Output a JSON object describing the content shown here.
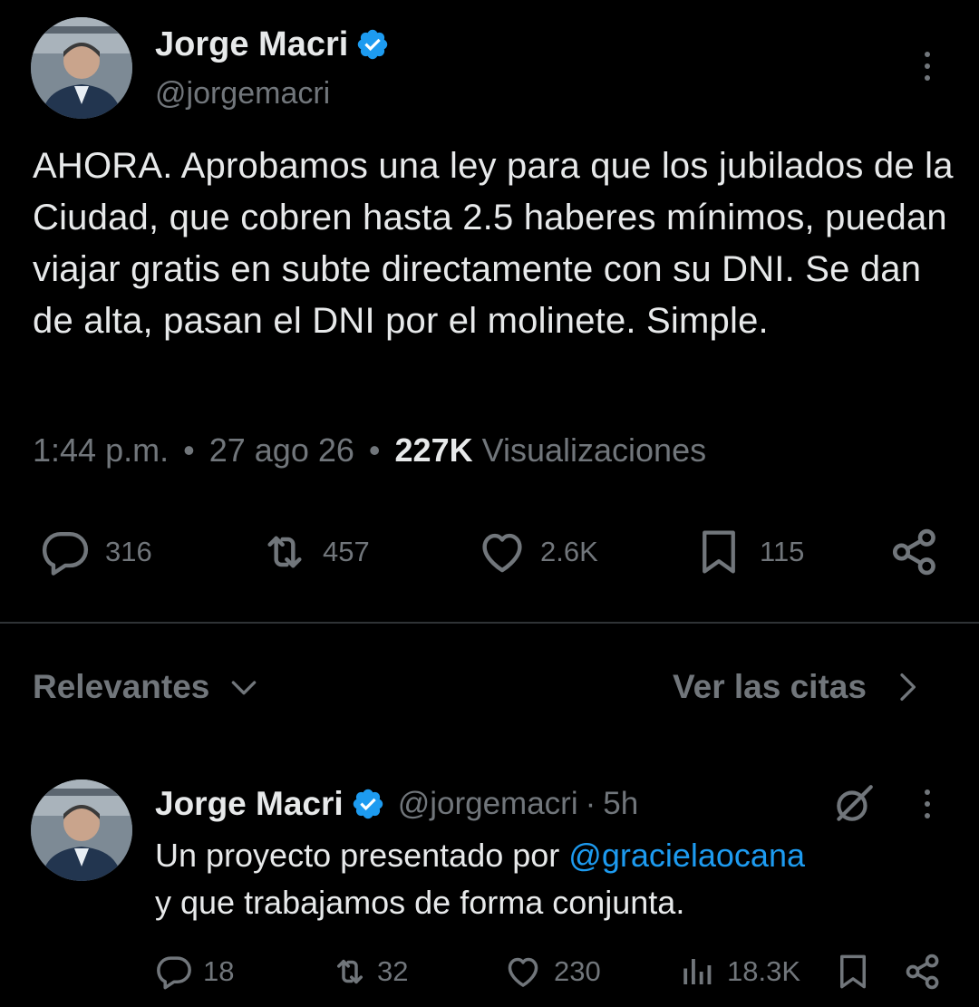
{
  "tweet": {
    "author_name": "Jorge Macri",
    "author_handle": "@jorgemacri",
    "text": "AHORA. Aprobamos una ley para que los jubilados de la Ciudad, que cobren hasta 2.5 haberes mínimos, puedan viajar gratis en subte directamente con su DNI. Se dan de alta, pasan el DNI por el molinete. Simple.",
    "time": "1:44 p.m.",
    "date": "27 ago 26",
    "views_count": "227K",
    "views_label": "Visualizaciones",
    "separator": "•",
    "actions": {
      "replies": "316",
      "retweets": "457",
      "likes": "2.6K",
      "bookmarks": "115"
    }
  },
  "sort_bar": {
    "sort_label": "Relevantes",
    "quotes_label": "Ver las citas"
  },
  "reply": {
    "author_name": "Jorge Macri",
    "author_handle": "@jorgemacri",
    "dot": "·",
    "age": "5h",
    "text_before": "Un proyecto presentado por ",
    "mention": "@gracielaocana",
    "text_after": "y que trabajamos de forma conjunta.",
    "actions": {
      "replies": "18",
      "retweets": "32",
      "likes": "230",
      "views": "18.3K"
    }
  },
  "colors": {
    "background": "#000000",
    "text_primary": "#e7e9ea",
    "text_secondary": "#71767b",
    "accent": "#1d9bf0",
    "divider": "#2f3336"
  },
  "icons": [
    "verified-badge-icon",
    "more-icon",
    "reply-icon",
    "retweet-icon",
    "like-icon",
    "bookmark-icon",
    "share-icon",
    "chevron-down-icon",
    "chevron-right-icon",
    "grok-icon",
    "views-icon"
  ]
}
